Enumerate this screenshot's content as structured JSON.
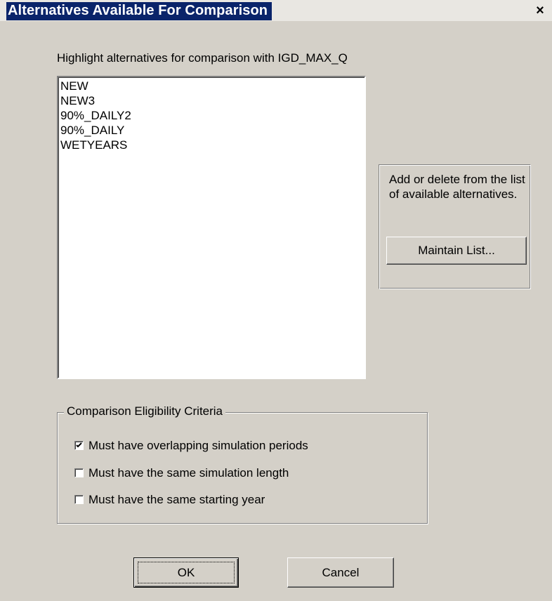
{
  "window": {
    "title": "Alternatives Available For Comparison",
    "close_glyph": "×"
  },
  "main": {
    "instruction": "Highlight alternatives for comparison with IGD_MAX_Q",
    "alternatives": [
      "NEW",
      "NEW3",
      "90%_DAILY2",
      "90%_DAILY",
      "WETYEARS"
    ]
  },
  "side_panel": {
    "description": "Add or delete from the list of available alternatives.",
    "maintain_label": "Maintain List..."
  },
  "criteria": {
    "legend": "Comparison Eligibility Criteria",
    "items": [
      {
        "label": "Must have overlapping simulation periods",
        "checked": true
      },
      {
        "label": "Must have the same simulation length",
        "checked": false
      },
      {
        "label": "Must have the same starting year",
        "checked": false
      }
    ]
  },
  "buttons": {
    "ok": "OK",
    "cancel": "Cancel"
  },
  "colors": {
    "title_bg": "#0a246a",
    "dialog_bg": "#d4d0c8"
  }
}
